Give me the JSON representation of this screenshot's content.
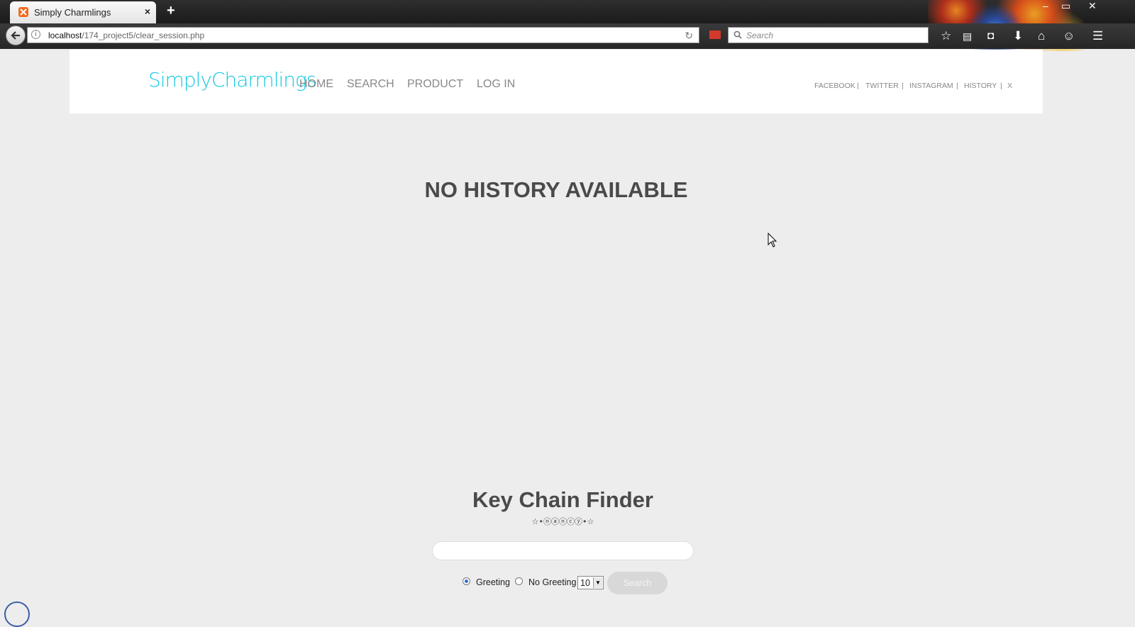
{
  "browser": {
    "tab_title": "Simply Charmlings",
    "tab_close": "×",
    "new_tab": "+",
    "url_host": "localhost",
    "url_path": "/174_project5/clear_session.php",
    "search_placeholder": "Search",
    "window_controls": [
      "–",
      "▭",
      "✕"
    ]
  },
  "site": {
    "logo": "SimplyCharmlings",
    "nav": [
      "HOME",
      "SEARCH",
      "PRODUCT",
      "LOG IN"
    ],
    "social": [
      "FACEBOOK",
      "TWITTER",
      "INSTAGRAM",
      "HISTORY",
      "X"
    ],
    "separator": "|"
  },
  "main": {
    "title": "NO HISTORY AVAILABLE"
  },
  "finder": {
    "title": "Key Chain Finder",
    "subtitle": "☆•ⓝⓐⓝⓒⓨ•☆",
    "input_value": "",
    "radio_greeting": "Greeting",
    "radio_no_greeting": "No Greeting",
    "greeting_selected": true,
    "count_value": "10",
    "search_button": "Search"
  },
  "colors": {
    "logo": "#17c8e0",
    "page_bg": "#ededed",
    "heading": "#4a4a4a"
  }
}
